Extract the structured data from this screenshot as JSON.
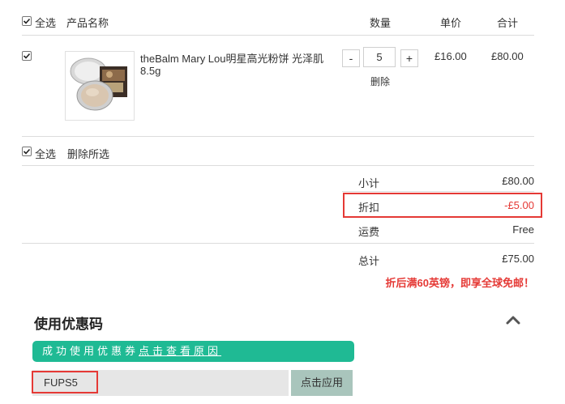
{
  "header": {
    "select_all": "全选",
    "product_name": "产品名称",
    "quantity": "数量",
    "unit_price": "单价",
    "total": "合计"
  },
  "item": {
    "checked": true,
    "name_line1": "theBalm Mary Lou明星高光粉饼 光泽肌",
    "name_line2": "8.5g",
    "qty_minus": "-",
    "qty_value": "5",
    "qty_plus": "+",
    "delete": "删除",
    "unit_price": "£16.00",
    "line_total": "£80.00"
  },
  "footer_select": {
    "select_all": "全选",
    "delete_selected": "删除所选"
  },
  "summary": {
    "subtotal_label": "小计",
    "subtotal_value": "£80.00",
    "discount_label": "折扣",
    "discount_value": "-£5.00",
    "shipping_label": "运费",
    "shipping_value": "Free",
    "total_label": "总计",
    "total_value": "£75.00",
    "free_shipping_note": "折后满60英镑，即享全球免邮！"
  },
  "promo": {
    "title": "使用优惠码",
    "success_prefix": "成功使用优惠券",
    "success_link": "点击查看原因",
    "code_value": "FUPS5",
    "apply_label": "点击应用"
  },
  "colors": {
    "accent_green": "#1fba94",
    "discount_red": "#e53935",
    "apply_button": "#a9c5bc"
  }
}
